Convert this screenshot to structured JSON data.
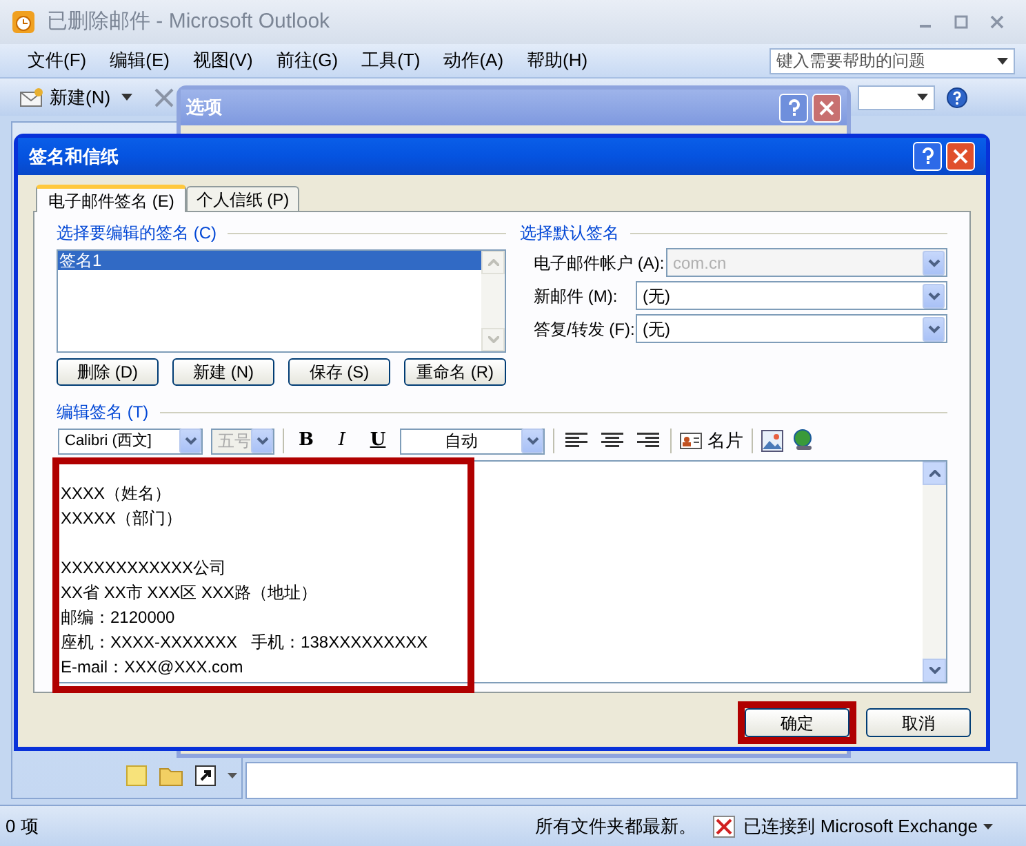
{
  "window": {
    "title": "已删除邮件 - Microsoft Outlook"
  },
  "menu": [
    {
      "label": "文件(F)"
    },
    {
      "label": "编辑(E)"
    },
    {
      "label": "视图(V)"
    },
    {
      "label": "前往(G)"
    },
    {
      "label": "工具(T)"
    },
    {
      "label": "动作(A)"
    },
    {
      "label": "帮助(H)"
    }
  ],
  "help_search": {
    "placeholder": "键入需要帮助的问题"
  },
  "toolbar": {
    "new_button": "新建(N)"
  },
  "options_dialog": {
    "title": "选项"
  },
  "signature_dialog": {
    "title": "签名和信纸",
    "tabs": [
      {
        "label": "电子邮件签名 (E)",
        "selected": true
      },
      {
        "label": "个人信纸 (P)",
        "selected": false
      }
    ],
    "edit_group": {
      "legend": "选择要编辑的签名 (C)",
      "signatures": [
        {
          "label": "签名1",
          "selected": true
        }
      ],
      "buttons": [
        "删除 (D)",
        "新建 (N)",
        "保存 (S)",
        "重命名 (R)"
      ]
    },
    "default_group": {
      "legend": "选择默认签名",
      "fields": [
        {
          "label": "电子邮件帐户 (A):",
          "value": "com.cn",
          "disabled": true
        },
        {
          "label": "新邮件 (M):",
          "value": "(无)",
          "disabled": false
        },
        {
          "label": "答复/转发 (F):",
          "value": "(无)",
          "disabled": false
        }
      ]
    },
    "editor": {
      "legend": "编辑签名 (T)",
      "font": "Calibri (西文]",
      "size": {
        "value": "五号",
        "disabled": true
      },
      "format_buttons": [
        "B",
        "I",
        "U"
      ],
      "color_field": "自动",
      "business_card": "名片",
      "blocks": [
        [
          "XXXX（姓名）",
          "XXXXX（部门）"
        ],
        [
          "XXXXXXXXXXXX公司",
          "XX省 XX市 XXX区 XXX路（地址）",
          "邮编：2120000",
          "座机：XXXX-XXXXXXX   手机：138XXXXXXXXX",
          "E-mail：XXX@XXX.com"
        ]
      ]
    },
    "buttons": [
      "确定",
      "取消"
    ]
  },
  "status_bar": {
    "count": "0 项",
    "sync": "所有文件夹都最新。",
    "connection": "已连接到 Microsoft Exchange"
  }
}
